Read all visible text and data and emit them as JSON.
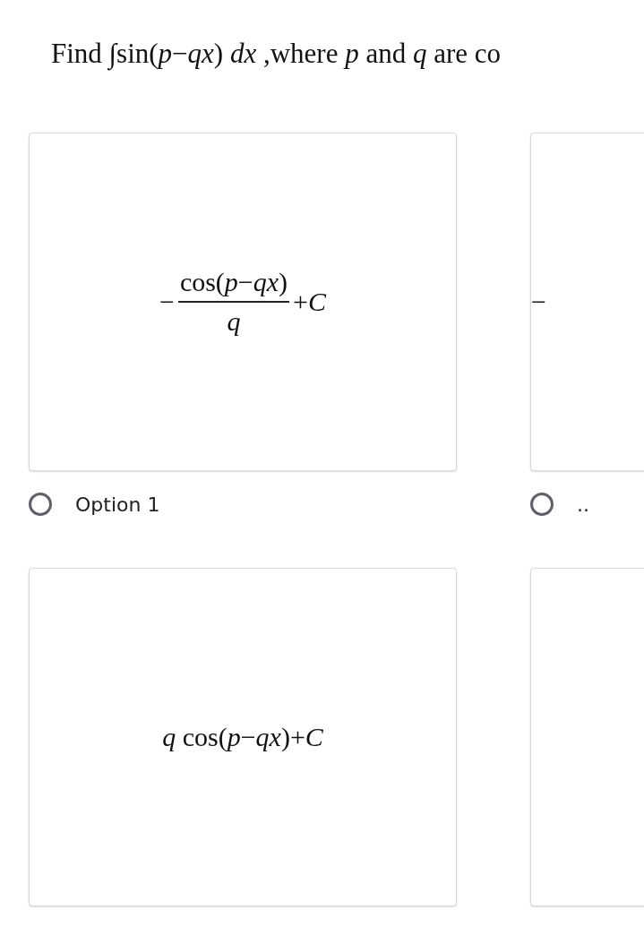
{
  "question": "Find ∫sin(*p*−*qx*) *dx* ,where *p* and *q* are co",
  "options": [
    {
      "kind": "answer",
      "formula": {
        "kind": "fraction",
        "sign": "−",
        "numerator": "cos(*p*−*qx*)",
        "denominator": "*q*",
        "suffix": "+*C*"
      },
      "label": "Option 1",
      "selected": false
    },
    {
      "kind": "answer",
      "formula": {
        "kind": "inline",
        "text": "−"
      },
      "label": "..",
      "selected": false
    },
    {
      "kind": "answer",
      "formula": {
        "kind": "inline",
        "text": "*q* cos(*p*−*qx*)+*C*"
      }
    },
    {
      "kind": "blank"
    }
  ]
}
